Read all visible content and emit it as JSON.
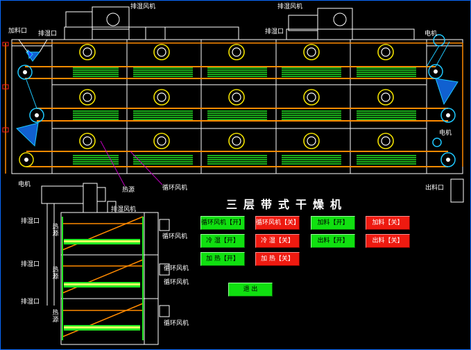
{
  "labels": {
    "fan_top_left": "排湿风机",
    "fan_top_right": "排湿风机",
    "feed_inlet": "加料口",
    "exhaust_port_1": "排湿口",
    "exhaust_port_2": "排湿口",
    "motor_top_right": "电机",
    "motor_mid_right": "电机",
    "motor_bottom_left": "电机",
    "discharge_port": "出料口",
    "heat_source": "热源",
    "circ_fan_main": "循环风机",
    "side_exhaust_fan": "排湿风机",
    "side_exhaust_port_1": "排湿口",
    "side_exhaust_port_2": "排湿口",
    "side_exhaust_port_3": "排湿口",
    "side_heat_1": "热源",
    "side_heat_2": "热源",
    "side_heat_3": "热源",
    "side_circ_fan_1": "循环风机",
    "side_circ_fan_2": "循环风机",
    "side_circ_fan_3": "循环风机",
    "side_circ_fan_4": "循环风机"
  },
  "title": "三层带式干燥机",
  "controls": {
    "circ_fan_on": "循环风机【开】",
    "circ_fan_off": "循环风机【关】",
    "exhaust_on": "冷 湿【开】",
    "exhaust_off": "冷 湿【关】",
    "heat_on": "加 热【开】",
    "heat_off": "加 热【关】",
    "feed_on": "加料【开】",
    "feed_off": "加料【关】",
    "discharge_on": "出料【开】",
    "discharge_off": "出料【关】",
    "exit": "退 出"
  },
  "colors": {
    "frame": "#ffffff",
    "belt": "#ff8a00",
    "heater": "#22e822",
    "fan_ring": "#f0e000",
    "accent": "#1ec8ff",
    "button_on": "#10e010",
    "button_off": "#ee1a10"
  }
}
